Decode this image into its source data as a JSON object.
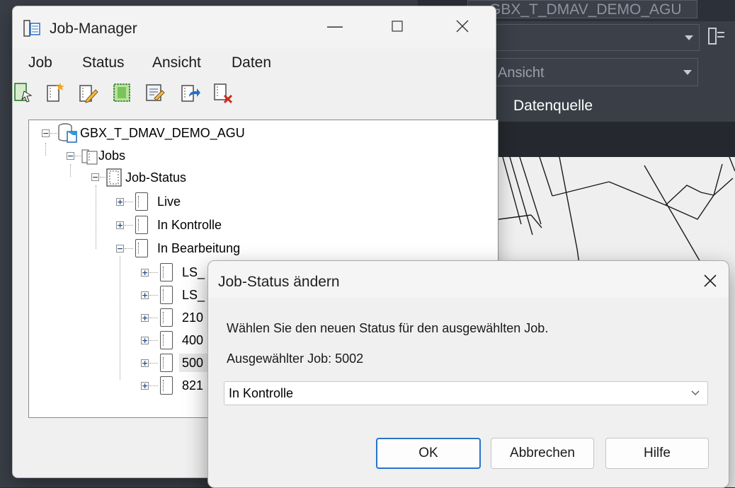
{
  "background_app": {
    "top_combo_text": "GBX_T_DMAV_DEMO_AGU",
    "view_combo_text": "Ansicht",
    "tab_label": "Datenquelle"
  },
  "job_manager": {
    "title": "Job-Manager",
    "menu": [
      "Job",
      "Status",
      "Ansicht",
      "Daten"
    ],
    "toolbar_icons": [
      "open-job-icon",
      "new-job-icon",
      "edit-job-icon",
      "job-properties-icon",
      "job-report-icon",
      "job-export-icon",
      "delete-job-icon"
    ],
    "tree": {
      "root": "GBX_T_DMAV_DEMO_AGU",
      "jobs": "Jobs",
      "job_status": "Job-Status",
      "live": "Live",
      "in_kontrolle": "In Kontrolle",
      "in_bearbeitung": "In Bearbeitung",
      "children": [
        "LS_",
        "LS_",
        "210",
        "400",
        "500",
        "821"
      ]
    }
  },
  "dialog": {
    "title": "Job-Status ändern",
    "message": "Wählen Sie den neuen Status für den ausgewählten Job.",
    "selected_job": "Ausgewählter Job: 5002",
    "status_value": "In Kontrolle",
    "ok_label": "OK",
    "cancel_label": "Abbrechen",
    "help_label": "Hilfe"
  },
  "colors": {
    "primary_button_border": "#2a73c9",
    "cad_background": "#3a3f47"
  }
}
